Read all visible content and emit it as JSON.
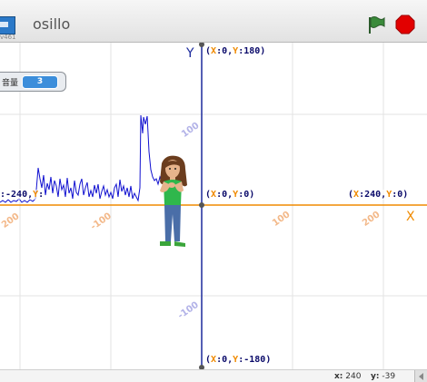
{
  "header": {
    "version": "v461",
    "title": "osillo",
    "icons": {
      "sprite": "sprite-thumbnail-icon",
      "flag": "green-flag-icon",
      "stop": "stop-sign-icon"
    },
    "colors": {
      "flag": "#2f7a2f",
      "stop": "#e00000"
    }
  },
  "stage": {
    "colors": {
      "x_axis": "#f08a00",
      "y_axis": "#1c2a9c",
      "grid": "#e3e3e3",
      "signal": "#1010d0",
      "label_key": "#f08a00",
      "label_value": "#0a0a6a"
    },
    "axis_letters": {
      "x": "X",
      "y": "Y"
    },
    "labels": {
      "top": {
        "key_x": "X",
        "val_x": "0",
        "key_y": "Y",
        "val_y": "180"
      },
      "center": {
        "key_x": "X",
        "val_x": "0",
        "key_y": "Y",
        "val_y": "0"
      },
      "right": {
        "key_x": "X",
        "val_x": "240",
        "key_y": "Y",
        "val_y": "0"
      },
      "bottom": {
        "key_x": "X",
        "val_x": "0",
        "key_y": "Y",
        "val_y": "-180"
      },
      "left_partial": {
        "prefix": ":-240,",
        "key_y": "Y",
        "val_y": ""
      }
    },
    "x_ticks": [
      "200",
      "-100",
      "100",
      "200"
    ],
    "y_ticks": [
      "100",
      "-100"
    ],
    "monitor": {
      "name": "音量",
      "value": "3"
    },
    "sprite": {
      "name": "girl-sprite"
    },
    "signal_trace": "x-axis baseline noise with a tall spike near the sprite"
  },
  "footer": {
    "x_label": "x:",
    "x_value": "240",
    "y_label": "y:",
    "y_value": "-39"
  }
}
